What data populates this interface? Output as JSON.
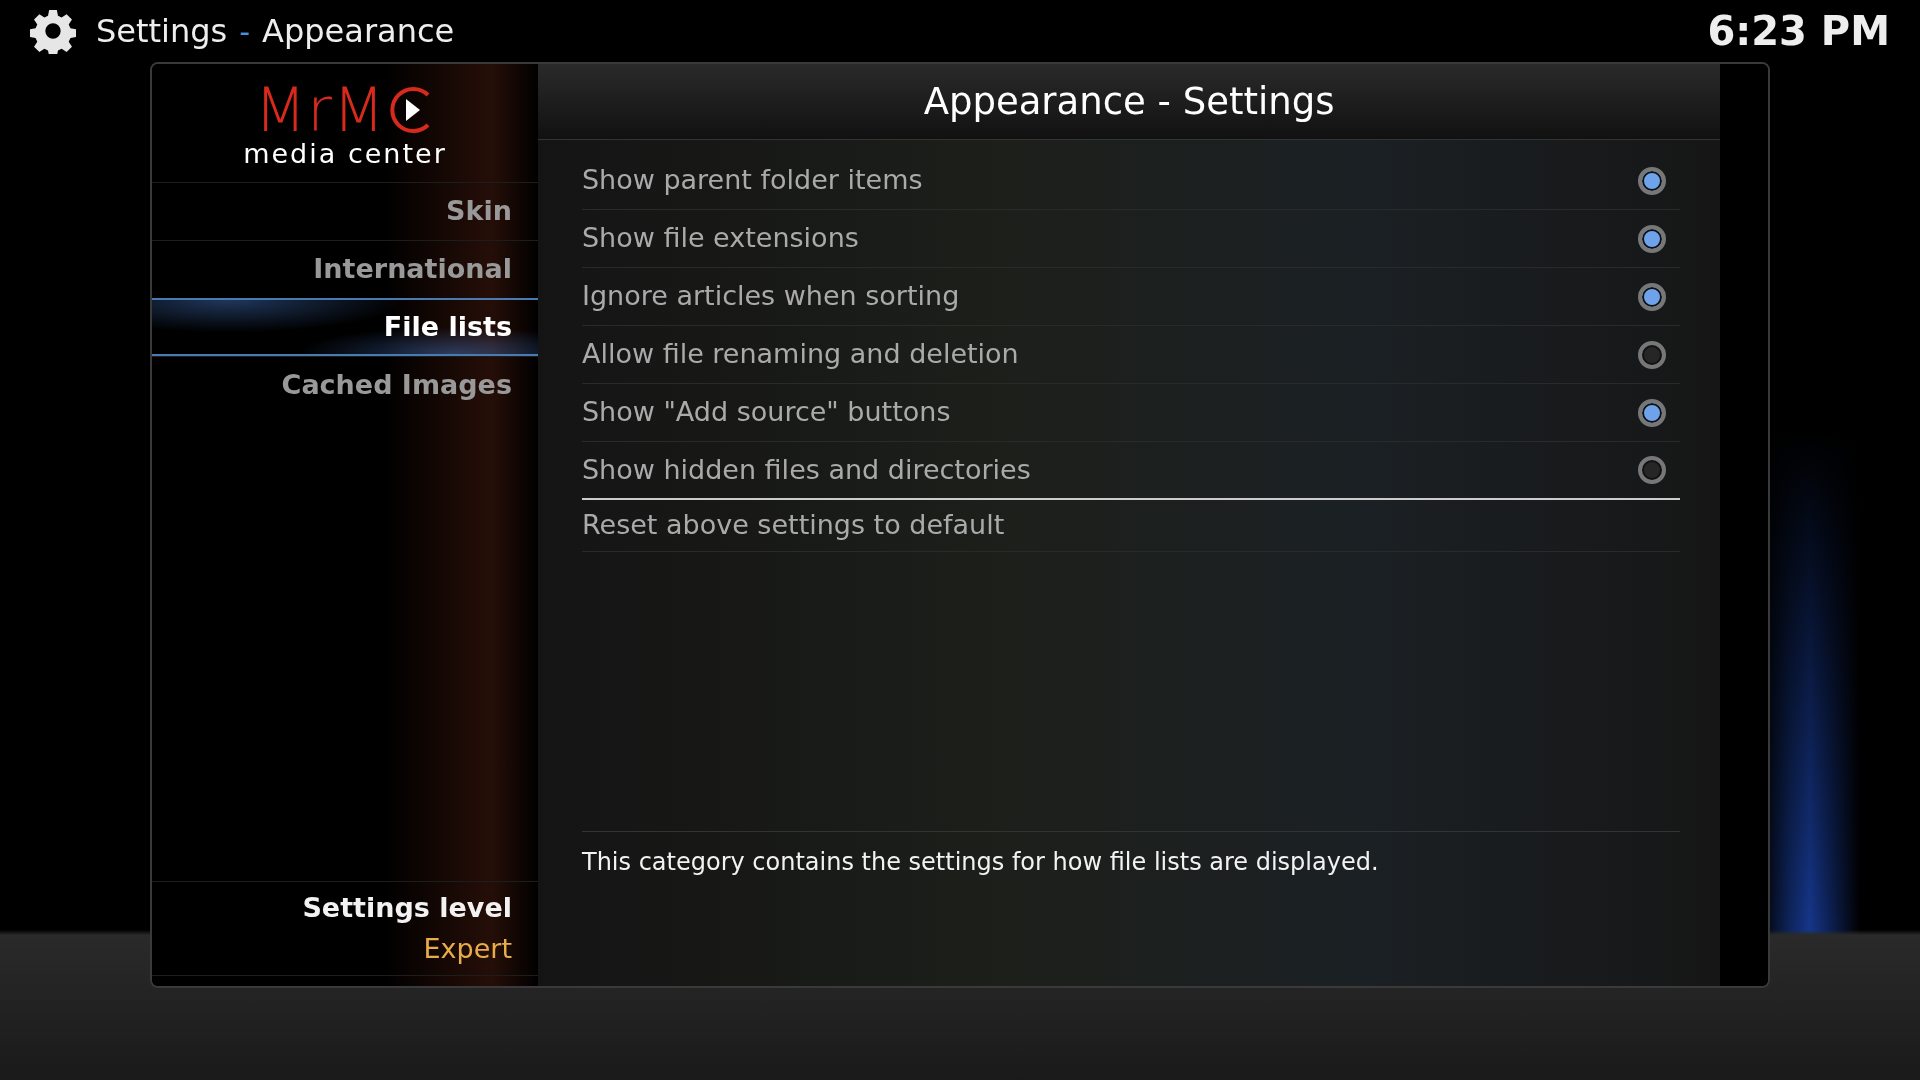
{
  "header": {
    "section": "Settings",
    "separator": "-",
    "page": "Appearance",
    "clock": "6:23 PM"
  },
  "logo": {
    "brand": "MrM",
    "tagline": "media center"
  },
  "sidebar": {
    "items": [
      {
        "label": "Skin",
        "selected": false
      },
      {
        "label": "International",
        "selected": false
      },
      {
        "label": "File lists",
        "selected": true
      },
      {
        "label": "Cached Images",
        "selected": false
      }
    ],
    "level_label": "Settings level",
    "level_value": "Expert"
  },
  "content": {
    "title": "Appearance - Settings",
    "settings": [
      {
        "kind": "toggle",
        "label": "Show parent folder items",
        "checked": true,
        "focused": false
      },
      {
        "kind": "toggle",
        "label": "Show file extensions",
        "checked": true,
        "focused": false
      },
      {
        "kind": "toggle",
        "label": "Ignore articles when sorting",
        "checked": true,
        "focused": false
      },
      {
        "kind": "toggle",
        "label": "Allow file renaming and deletion",
        "checked": false,
        "focused": false
      },
      {
        "kind": "toggle",
        "label": "Show \"Add source\" buttons",
        "checked": true,
        "focused": false
      },
      {
        "kind": "toggle",
        "label": "Show hidden files and directories",
        "checked": false,
        "focused": true
      },
      {
        "kind": "action",
        "label": "Reset above settings to default"
      }
    ],
    "description": "This category contains the settings for how file lists are displayed."
  }
}
